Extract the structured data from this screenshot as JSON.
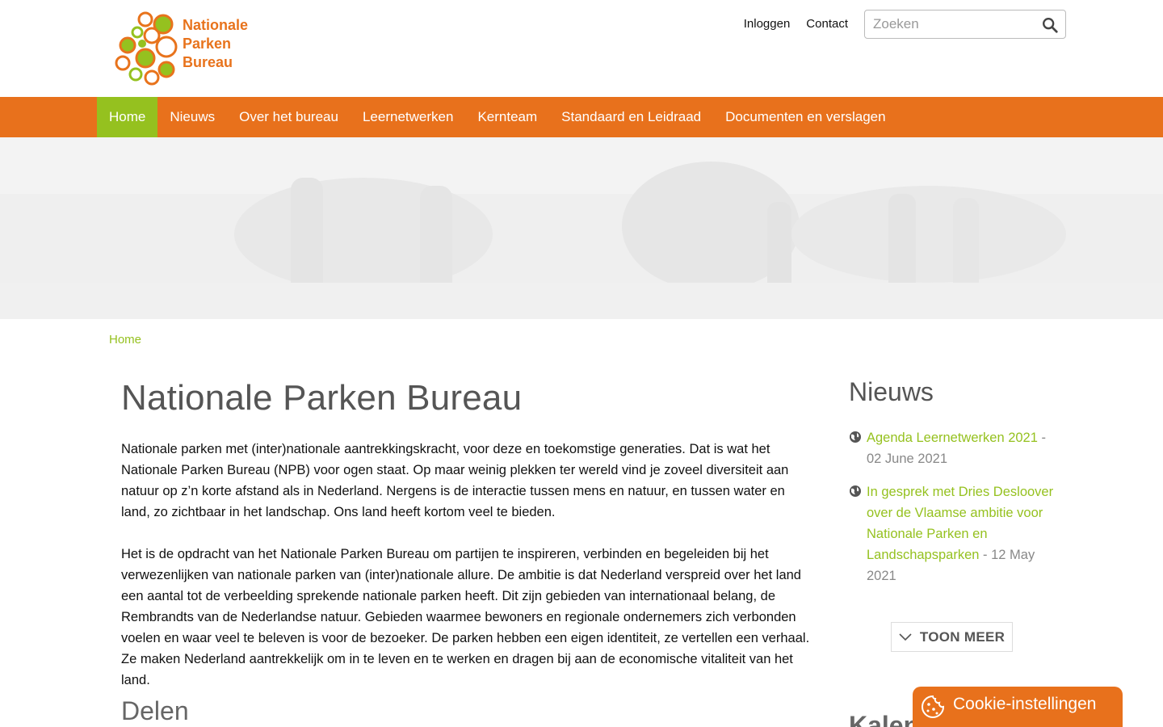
{
  "header": {
    "logo_lines": [
      "Nationale",
      "Parken",
      "Bureau"
    ],
    "top_links": [
      "Inloggen",
      "Contact"
    ],
    "search_placeholder": "Zoeken"
  },
  "nav": {
    "items": [
      "Home",
      "Nieuws",
      "Over het bureau",
      "Leernetwerken",
      "Kernteam",
      "Standaard en Leidraad",
      "Documenten en verslagen"
    ],
    "active": "Home"
  },
  "breadcrumb": "Home",
  "main": {
    "title": "Nationale Parken Bureau",
    "paragraphs": [
      "Nationale parken met (inter)nationale aantrekkingskracht, voor deze en toekomstige generaties. Dat is wat het Nationale Parken Bureau (NPB) voor ogen staat. Op maar weinig plekken ter wereld vind je zoveel diversiteit aan natuur op z’n korte afstand als in Nederland. Nergens is de interactie tussen mens en natuur, en tussen water en land, zo zichtbaar in het landschap. Ons land heeft kortom veel te bieden.",
      "Het is de opdracht van het Nationale Parken Bureau om partijen te inspireren, verbinden en begeleiden bij het verwezenlijken van nationale parken van (inter)nationale allure. De ambitie is dat Nederland verspreid over het land een aantal tot de verbeelding sprekende nationale parken heeft. Dit zijn gebieden van internationaal belang, de Rembrandts van de Nederlandse natuur. Gebieden waarmee bewoners en regionale ondernemers zich verbonden voelen en waar veel te beleven is voor de bezoeker. De parken hebben een eigen identiteit, ze vertellen een verhaal. Ze maken Nederland aantrekkelijk om in te leven en te werken en dragen bij aan de economische vitaliteit van het land."
    ],
    "share_title": "Delen"
  },
  "sidebar": {
    "title": "Nieuws",
    "news": [
      {
        "title": "Agenda Leernetwerken 2021",
        "date": " - 02 June 2021"
      },
      {
        "title": "In gesprek met Dries Desloover over de Vlaamse ambitie voor Nationale Parken en Landschapsparken",
        "date": " - 12 May 2021"
      }
    ],
    "more_label": "TOON MEER",
    "second_title": "Kalender"
  },
  "cookie": {
    "label": "Cookie-instellingen"
  },
  "colors": {
    "brand_orange": "#e8711c",
    "brand_green": "#95c11f"
  }
}
